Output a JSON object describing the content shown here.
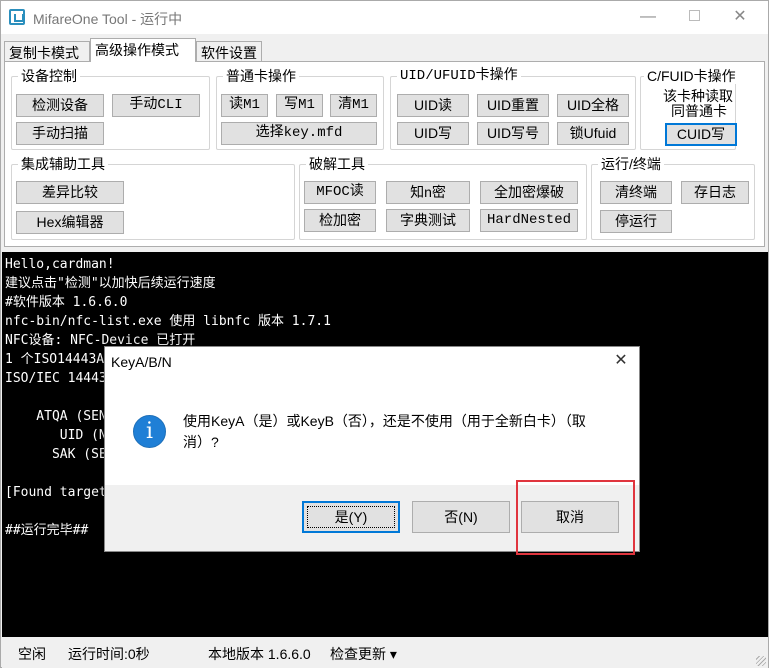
{
  "window": {
    "title": "MifareOne Tool - 运行中",
    "close_glyph": "✕",
    "min_glyph": "—"
  },
  "tabs": [
    {
      "label": "复制卡模式",
      "active": false
    },
    {
      "label": "高级操作模式",
      "active": true
    },
    {
      "label": "软件设置",
      "active": false
    }
  ],
  "groups": {
    "device": {
      "label": "设备控制",
      "buttons": {
        "detect": "检测设备",
        "cli": "手动CLI",
        "scan": "手动扫描"
      }
    },
    "normal": {
      "label": "普通卡操作",
      "buttons": {
        "read": "读M1",
        "write": "写M1",
        "clear": "清M1",
        "select_key": "选择key.mfd"
      }
    },
    "uid": {
      "label": "UID/UFUID卡操作",
      "buttons": {
        "uid_read": "UID读",
        "uid_reset": "UID重置",
        "uid_format": "UID全格",
        "uid_write": "UID写",
        "uid_write_num": "UID写号",
        "lock_ufuid": "锁Ufuid"
      }
    },
    "cfuid": {
      "label": "C/FUID卡操作",
      "line1": "该卡种读取",
      "line2": "同普通卡",
      "buttons": {
        "cuid_write": "CUID写"
      }
    },
    "tools": {
      "label": "集成辅助工具",
      "buttons": {
        "diff": "差异比较",
        "hex": "Hex编辑器"
      }
    },
    "crack": {
      "label": "破解工具",
      "buttons": {
        "mfoc": "MFOC读",
        "known": "知n密",
        "full_crack": "全加密爆破",
        "check_key": "检加密",
        "dict": "字典测试",
        "hardnested": "HardNested"
      }
    },
    "run": {
      "label": "运行/终端",
      "buttons": {
        "clear_term": "清终端",
        "save_log": "存日志",
        "stop": "停运行"
      }
    }
  },
  "console": {
    "lines": [
      "Hello,cardman!",
      "建议点击\"检测\"以加快后续运行速度",
      "#软件版本 1.6.6.0",
      "nfc-bin/nfc-list.exe 使用 libnfc 版本 1.7.1",
      "NFC设备: NFC-Device 已打开",
      "1 个ISO14443A",
      "ISO/IEC 14443",
      "",
      "    ATQA (SEN",
      "       UID (N",
      "      SAK (SE",
      "",
      "[Found target",
      "",
      "##运行完毕##"
    ]
  },
  "statusbar": {
    "state": "空闲",
    "runtime": "运行时间:0秒",
    "version": "本地版本 1.6.6.0",
    "update": "检查更新 ▾"
  },
  "dialog": {
    "title": "KeyA/B/N",
    "close_glyph": "✕",
    "icon": "info-icon",
    "icon_glyph": "i",
    "message": "使用KeyA（是）或KeyB（否），还是不使用（用于全新白卡）（取消）?",
    "buttons": {
      "yes": "是(Y)",
      "no": "否(N)",
      "cancel": "取消"
    }
  },
  "colors": {
    "accent": "#0078d7",
    "highlight": "#e0353e",
    "console_bg": "#000000"
  }
}
